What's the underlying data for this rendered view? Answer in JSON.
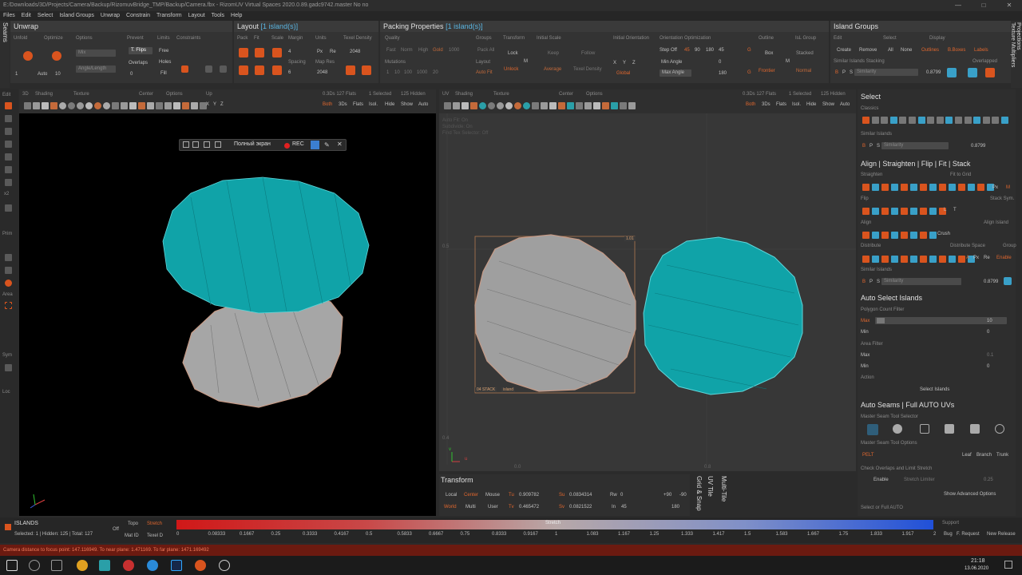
{
  "window": {
    "title": "E:/Downloads/3D/Projects/Camera/Backup/RizomuvBridge_TMP/Backup/Camera.fbx - RizomUV  Virtual Spaces 2020.0.89.gadc9742.master No no"
  },
  "menu": [
    "Files",
    "Edit",
    "Select",
    "Island Groups",
    "Unwrap",
    "Constrain",
    "Transform",
    "Layout",
    "Tools",
    "Help"
  ],
  "unwrap": {
    "title": "Unwrap",
    "side_label": "Seams",
    "subs": [
      "Unfold",
      "Optimize",
      "Options",
      "Prevent",
      "Limits",
      "Constraints"
    ],
    "mix": "Mix",
    "angle_length": "Angle/Length",
    "t_flips": "T. Flips",
    "free": "Free",
    "overlaps": "Overlaps",
    "holes": "Holes",
    "fill": "Fill",
    "v1": "1",
    "auto": "Auto",
    "v10": "10",
    "v0": "0"
  },
  "layout": {
    "title": "Layout",
    "count": "[1 island(s)]",
    "subs": [
      "Pack",
      "Fit",
      "Scale",
      "Margin",
      "Units",
      "Texel Density"
    ],
    "v4": "4",
    "px": "Px",
    "re": "Re",
    "v2048": "2048",
    "spacing": "Spacing",
    "map_res": "Map Res",
    "v6": "6",
    "v2048b": "2048"
  },
  "packing": {
    "title": "Packing Properties",
    "count": "[1 island(s)]",
    "subs": [
      "Quality",
      "Groups",
      "Transform",
      "Initial Scale",
      "Initial Orientation",
      "Orientation Optimization"
    ],
    "quality": [
      "Fast",
      "Norm",
      "High",
      "Gold"
    ],
    "q1000": "1000",
    "pack_all": "Pack All",
    "lock": "Lock",
    "keep": "Keep",
    "follow": "Follow",
    "mutations": "Mutations",
    "mut_vals": [
      "1",
      "10",
      "100",
      "1000",
      "20"
    ],
    "layout_lbl": "Layout",
    "auto_fit": "Auto Fit",
    "unlock": "Unlock",
    "m": "M",
    "average": "Average",
    "texel_density": "Texel Density",
    "step_off": "Step Off",
    "step_vals": [
      "45",
      "90",
      "180",
      "45"
    ],
    "xyz": [
      "X",
      "Y",
      "Z"
    ],
    "global": "Global",
    "min_angle": "Min Angle",
    "min_angle_val": "0",
    "max_angle": "Max Angle",
    "max_angle_val": "180",
    "outline": "Outline",
    "box": "Box",
    "frontier": "Frontier",
    "isl_group": "IsL Group",
    "stacked": "Stacked",
    "normal": "Normal",
    "g": "G",
    "mm": "M"
  },
  "island_groups": {
    "title": "Island Groups",
    "subs": [
      "Edit",
      "Select",
      "Display"
    ],
    "create": "Create",
    "remove": "Remove",
    "all": "All",
    "none": "None",
    "outlines": "Outlines",
    "bboxes": "B.Boxes",
    "labels": "Labels",
    "similar_stacking": "Similar Islands Stacking",
    "overlapped": "Overlapped",
    "similarity": "Similarity",
    "similarity_val": "0.8799",
    "bps": [
      "B",
      "P",
      "S"
    ]
  },
  "right_tabs": [
    "Projections",
    "Texture Multipliers"
  ],
  "left_tools": [
    "Edit",
    "x2",
    "Prim",
    "Area",
    "Sym",
    "Loc"
  ],
  "view3d": {
    "menu": [
      "3D",
      "Shading",
      "Texture",
      "Center",
      "Options",
      "Up"
    ],
    "stats": "0.3Ds 127 Flats",
    "selected": "1 Selected",
    "hidden": "125 Hidden",
    "both": "Both",
    "ds3": "3Ds",
    "flats": "Flats",
    "isol": "Isol.",
    "hide": "Hide",
    "show": "Show",
    "auto": "Auto",
    "xyz": [
      "X",
      "Y",
      "Z"
    ],
    "rec_bar": {
      "fullscreen": "Полный экран",
      "rec": "REC"
    }
  },
  "uv_view": {
    "menu": [
      "UV",
      "Shading",
      "Texture",
      "Center",
      "Options"
    ],
    "stats": "0.3Ds 127 Flats",
    "selected": "1 Selected",
    "hidden": "125 Hidden",
    "both": "Both",
    "ds3": "3Ds",
    "flats": "Flats",
    "isol": "Isol.",
    "hide": "Hide",
    "show": "Show",
    "auto": "Auto",
    "info": [
      "Auto Fit: On",
      "Subdivide: On",
      "Find Tex Selector: Off"
    ],
    "box_label": "1.01",
    "stack_label": "04 STACK",
    "stack_label2": "island",
    "axis_05": "0.5",
    "axis_04": "0.4",
    "axis_0": "0.0",
    "axis_x": "0.8",
    "axis_v": "v",
    "axis_u": "u"
  },
  "transform": {
    "title": "Transform",
    "local": "Local",
    "center": "Center",
    "mouse": "Mouse",
    "world": "World",
    "multi": "Multi",
    "user": "User",
    "tu": "Tu",
    "tu_val": "0.909782",
    "tv": "Tv",
    "tv_val": "0.465472",
    "su": "Su",
    "su_val": "0.0834314",
    "sv": "Sv",
    "sv_val": "0.0821522",
    "rw": "Rw",
    "rw_val": "0",
    "in": "In",
    "in_val": "45",
    "p90": "+90",
    "m90": "-90",
    "v180": "180"
  },
  "vtabs": [
    "Grid & Snap",
    "UV Tile",
    "Multi-Tile"
  ],
  "select_panel": {
    "title": "Select",
    "classics": "Classics",
    "similar_islands": "Similar Islands",
    "similarity": "Similarity",
    "similarity_val": "0.8799",
    "bps": [
      "B",
      "P",
      "S"
    ]
  },
  "align_panel": {
    "title": "Align | Straighten | Flip | Fit | Stack",
    "straighten": "Straighten",
    "fit_to_grid": "Fit to Grid",
    "flip": "Flip",
    "stack_sym": "Stack Sym.",
    "align": "Align",
    "crush": "Crush",
    "align_island": "Align Island",
    "distribute": "Distribute",
    "distribute_space": "Distribute Space",
    "group": "Group",
    "a": "A",
    "px": "Px",
    "re": "Re",
    "enable": "Enable",
    "similar_islands": "Similar Islands",
    "similarity": "Similarity",
    "similarity_val": "0.8799",
    "l": "L",
    "t": "T",
    "m": "M"
  },
  "auto_select": {
    "title": "Auto Select Islands",
    "poly_filter": "Polygon Count Filter",
    "max": "Max",
    "max_val": "10",
    "min": "Min",
    "min_val": "0",
    "area_filter": "Area Filter",
    "amax": "Max",
    "amax_val": "0.1",
    "amin": "Min",
    "amin_val": "0",
    "action": "Action",
    "select_islands": "Select Islands"
  },
  "auto_seams": {
    "title": "Auto Seams | Full AUTO UVs",
    "master_selector": "Master Seam Tool Selector",
    "master_options": "Master Seam Tool Options",
    "pelt": "PELT",
    "leaf": "Leaf",
    "branch": "Branch",
    "trunk": "Trunk",
    "check_overlaps": "Check Overlaps and Limit Stretch",
    "enable": "Enable",
    "stretch_limiter": "Stretch Limiter",
    "stretch_val": "0.25",
    "show_advanced": "Show Advanced Options",
    "select_or_full": "Select or Full AUTO"
  },
  "bottom": {
    "islands": "ISLANDS",
    "counts": "Selected: 1 | Hidden: 125 | Total: 127",
    "off": "Off",
    "topo": "Topo",
    "stretch": "Stretch",
    "mat_id": "Mat ID",
    "texel_d": "Texel D",
    "gradient_label": "Stretch",
    "ticks": [
      "0",
      "0.08333",
      "0.1667",
      "0.25",
      "0.3333",
      "0.4167",
      "0.5",
      "0.5833",
      "0.6667",
      "0.75",
      "0.8333",
      "0.9167",
      "1",
      "1.083",
      "1.167",
      "1.25",
      "1.333",
      "1.417",
      "1.5",
      "1.583",
      "1.667",
      "1.75",
      "1.833",
      "1.917",
      "2"
    ],
    "support": "Support",
    "bug": "Bug",
    "f_request": "F. Request",
    "new_release": "New Release"
  },
  "status": {
    "text": "Camera distance to focus point: 147.116949. To near plane: 1.471169. To far plane: 1471.169492"
  },
  "taskbar": {
    "time": "21:18",
    "date": "13.06.2020"
  },
  "colors": {
    "accent": "#d9541e",
    "island": "#10a3a8",
    "selected_island": "#9f9f9f"
  }
}
